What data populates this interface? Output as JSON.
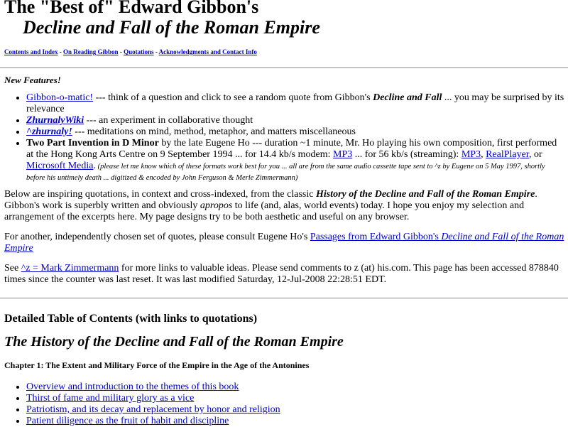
{
  "header": {
    "title_line1": "The \"Best of\" Edward Gibbon's",
    "title_line2": "Decline and Fall of the Roman Empire"
  },
  "nav": {
    "items": [
      "Contents and Index",
      "On Reading Gibbon",
      "Quotations",
      "Acknowledgments and Contact Info"
    ],
    "separator": " - "
  },
  "new_features": {
    "heading": "New Features!",
    "gibbon_link": "Gibbon-o-matic!",
    "gibbon_text1": " --- think of a question and click to see a random quote from Gibbon's ",
    "gibbon_bold": "Decline and Fall",
    "gibbon_text2": " ... you may be surprised by its relevance",
    "wiki_link": "ZhurnalyWiki",
    "wiki_text": " --- an experiment in collaborative thought",
    "zhurnaly_link": "^zhurnaly!",
    "zhurnaly_text": " --- meditations on mind, method, metaphor, and matters miscellaneous",
    "invention_bold": "Two Part Invention in D Minor",
    "invention_text": " by the late Eugene Ho --- duration ~1 minute, Mr. Ho playing his own composition, first performed at the Hong Kong Arts Centre on 9 September 1994 ... for 14.4 kb/s modem: ",
    "mp3_link_1": "MP3",
    "invention_text2": " ... for 56 kb/s (streaming): ",
    "mp3_link_2": "MP3",
    "comma": ", ",
    "realplayer_link": "RealPlayer",
    "or_text": ", or ",
    "media_link": "Microsoft Media",
    "period": ".",
    "note": " (please let me know which of these formats work best for you ... all are from the same audio cassette tape sent to ^z by Eugene on 5 May 1997, shortly before his untimely death ... digitized & encoded by John Ferguson & Merle Zimmermann)"
  },
  "intro": {
    "p1_a": "Below are inspiring quotations, in context and cross-indexed, from the classic ",
    "p1_italic": "History of the Decline and Fall of the Roman Empire",
    "p1_b": ". Gibbon's work is superbly written and obviously ",
    "p1_apropos": "apropos",
    "p1_c": " to life (and, alas, world events) today. I hope you enjoy my selection and arrangement of the excerpts here. My page designs try to be both aesthetic and useful on any browser.",
    "p2_a": "For another, independently chosen set of quotes, please consult Eugene Ho's ",
    "p2_link_a": "Passages from Edward Gibbon's ",
    "p2_link_italic": "Decline and Fall of the Roman Empire",
    "p3_a": "See ",
    "p3_link": "^z = Mark Zimmermann",
    "p3_b": " for more links to valuable ideas. Please send comments to z (at) his.com. This page has been accessed 878840 times since the counter was last reset. It was last modified Saturday, 12-Jul-2008 22:28:51 EDT."
  },
  "toc": {
    "heading": "Detailed Table of Contents (with links to quotations)",
    "book_title": "The History of the Decline and Fall of the Roman Empire",
    "chapter1": "Chapter 1: The Extent and Military Force of the Empire in the Age of the Antonines",
    "items": [
      "Overview and introduction to the themes of this book",
      "Thirst of fame and military glory as a vice",
      "Patriotism, and its decay and replacement by honor and religion",
      "Patient diligence as the fruit of habit and discipline"
    ]
  },
  "colors": {
    "link": "#0000cc",
    "rule": "#888888"
  }
}
